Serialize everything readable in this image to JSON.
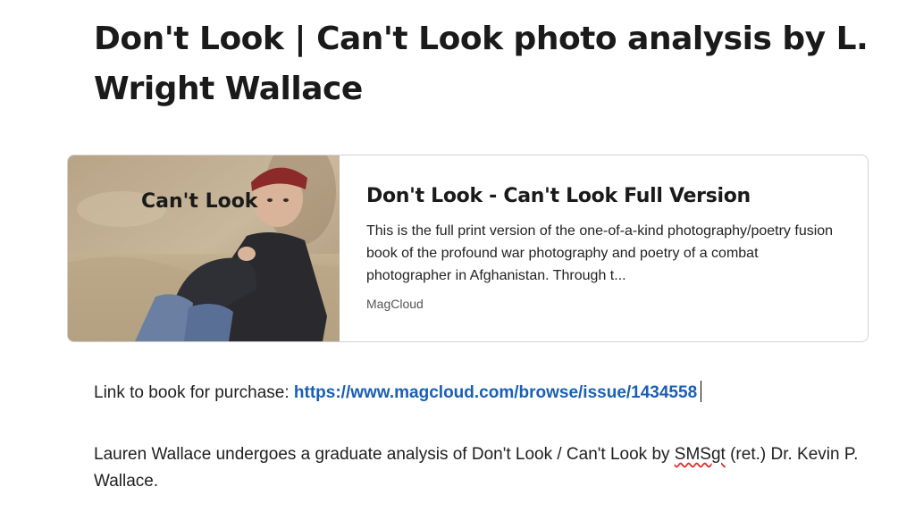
{
  "page": {
    "title": "Don't Look | Can't Look photo analysis by L. Wright Wallace"
  },
  "embed_card": {
    "image_caption": "Can't Look",
    "title": "Don't Look - Can't Look Full Version",
    "description": "This is the full print version of the one-of-a-kind photography/poetry fusion book of the profound war photography and poetry of a combat photographer in Afghanistan. Through t...",
    "source": "MagCloud"
  },
  "purchase": {
    "label": "Link to book for purchase: ",
    "url_text": "https://www.magcloud.com/browse/issue/1434558"
  },
  "analysis": {
    "text_before": "Lauren Wallace undergoes a graduate analysis of Don't Look / Can't Look by ",
    "misspelled_word": "SMSgt",
    "text_after": " (ret.) Dr. Kevin P. Wallace."
  },
  "colors": {
    "link": "#1a5fb4",
    "card_border": "#d3d3d3",
    "spellcheck_underline": "#d33"
  }
}
